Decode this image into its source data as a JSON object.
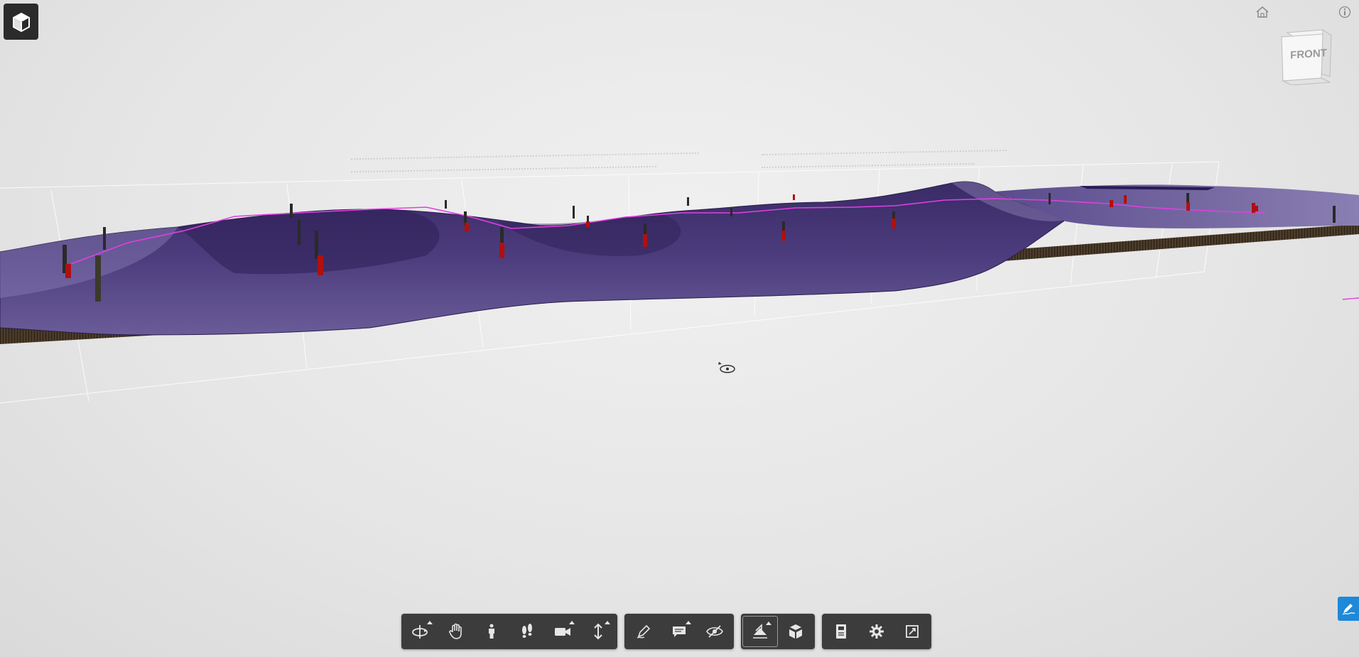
{
  "viewer": {
    "viewcube_face": "FRONT",
    "accent_color": "#1e88d9",
    "surface_color": "#4b3a78",
    "borehole_marker_color": "#b01010",
    "profile_line_color": "#e040e0"
  },
  "top_controls": {
    "model_browser_icon": "cube-icon",
    "home_icon": "home-icon",
    "info_icon": "info-icon"
  },
  "toolbar": {
    "navigation": [
      {
        "name": "orbit",
        "icon": "orbit-icon",
        "has_menu": true
      },
      {
        "name": "pan",
        "icon": "hand-icon",
        "has_menu": false
      },
      {
        "name": "first-person",
        "icon": "person-icon",
        "has_menu": false
      },
      {
        "name": "walk",
        "icon": "footprints-icon",
        "has_menu": false
      },
      {
        "name": "camera",
        "icon": "camera-icon",
        "has_menu": true
      },
      {
        "name": "elevation",
        "icon": "up-down-icon",
        "has_menu": true
      }
    ],
    "review": [
      {
        "name": "markup",
        "icon": "pencil-icon",
        "has_menu": false
      },
      {
        "name": "comment",
        "icon": "comment-icon",
        "has_menu": true
      },
      {
        "name": "hide",
        "icon": "eye-slash-icon",
        "has_menu": false
      }
    ],
    "model": [
      {
        "name": "section",
        "icon": "section-plane-icon",
        "has_menu": true,
        "active": true
      },
      {
        "name": "explode",
        "icon": "explode-cube-icon",
        "has_menu": false
      }
    ],
    "settings": [
      {
        "name": "properties",
        "icon": "properties-icon",
        "has_menu": false
      },
      {
        "name": "settings",
        "icon": "gear-icon",
        "has_menu": false
      },
      {
        "name": "fullscreen",
        "icon": "fullscreen-icon",
        "has_menu": false
      }
    ]
  },
  "side_panel_icon": "markup-sign-icon"
}
